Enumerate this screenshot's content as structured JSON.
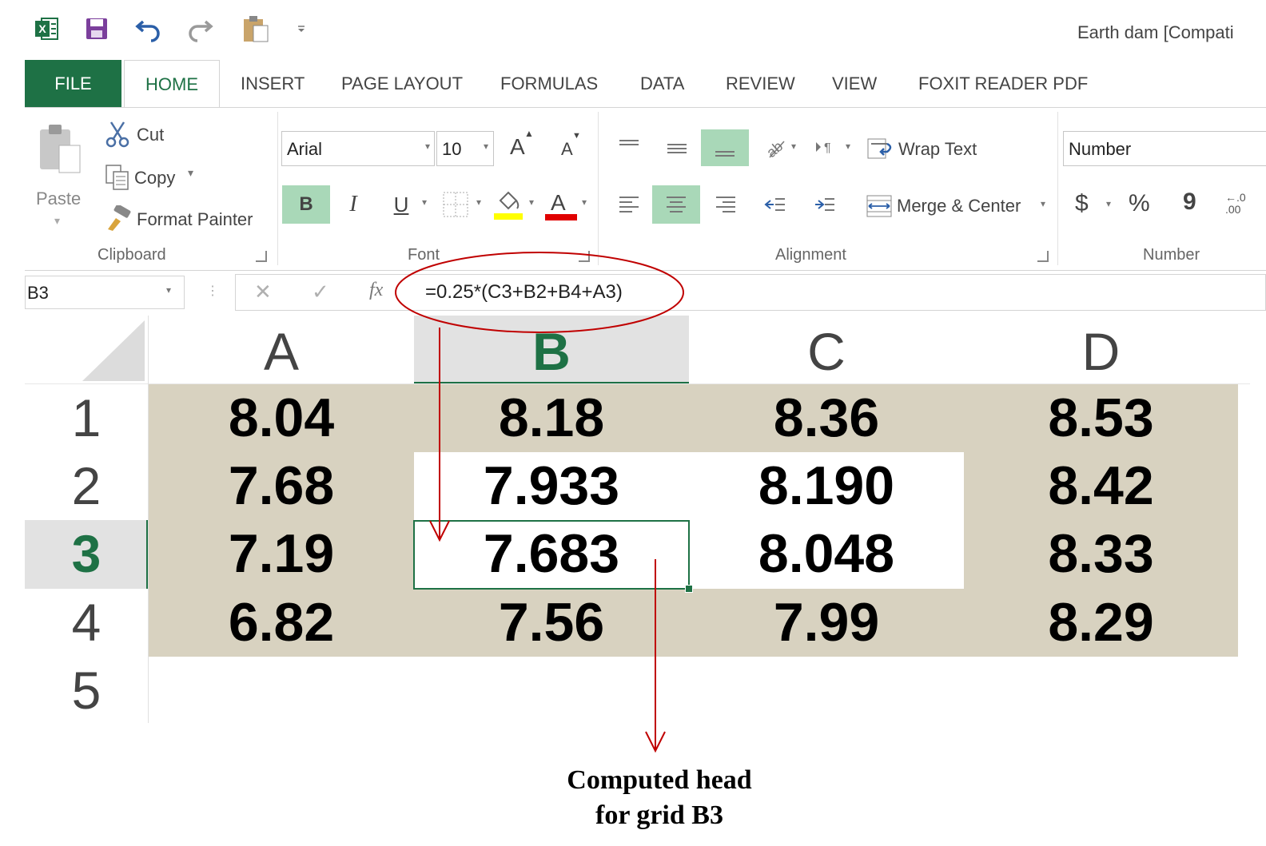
{
  "window": {
    "title": "Earth dam  [Compati"
  },
  "tabs": [
    {
      "label": "FILE"
    },
    {
      "label": "HOME"
    },
    {
      "label": "INSERT"
    },
    {
      "label": "PAGE LAYOUT"
    },
    {
      "label": "FORMULAS"
    },
    {
      "label": "DATA"
    },
    {
      "label": "REVIEW"
    },
    {
      "label": "VIEW"
    },
    {
      "label": "FOXIT READER PDF"
    }
  ],
  "clipboard": {
    "paste": "Paste",
    "cut": "Cut",
    "copy": "Copy",
    "format_painter": "Format Painter",
    "label": "Clipboard"
  },
  "font": {
    "name": "Arial",
    "size": "10",
    "label": "Font",
    "bold": "B",
    "italic": "I",
    "underline": "U",
    "font_color_letter": "A",
    "grow": "A",
    "shrink": "A"
  },
  "alignment": {
    "wrap_text": "Wrap Text",
    "merge_center": "Merge & Center",
    "label": "Alignment"
  },
  "number": {
    "format": "Number",
    "label": "Number",
    "currency": "$",
    "percent": "%",
    "comma": "9",
    "decimal": "←.0\n.00"
  },
  "formula_bar": {
    "name_box": "B3",
    "fx": "fx",
    "formula": "=0.25*(C3+B2+B4+A3)"
  },
  "grid": {
    "columns": [
      "A",
      "B",
      "C",
      "D"
    ],
    "rows": [
      "1",
      "2",
      "3",
      "4",
      "5"
    ],
    "cells": [
      [
        "8.04",
        "8.18",
        "8.36",
        "8.53"
      ],
      [
        "7.68",
        "7.933",
        "8.190",
        "8.42"
      ],
      [
        "7.19",
        "7.683",
        "8.048",
        "8.33"
      ],
      [
        "6.82",
        "7.56",
        "7.99",
        "8.29"
      ]
    ],
    "active_cell": "B3"
  },
  "annotation": {
    "line1": "Computed head",
    "line2": "for grid B3"
  },
  "colors": {
    "excel_green": "#1e7145",
    "cell_fill": "#d8d2c0",
    "highlight": "#a9d8b8",
    "annotation_red": "#c00000"
  }
}
